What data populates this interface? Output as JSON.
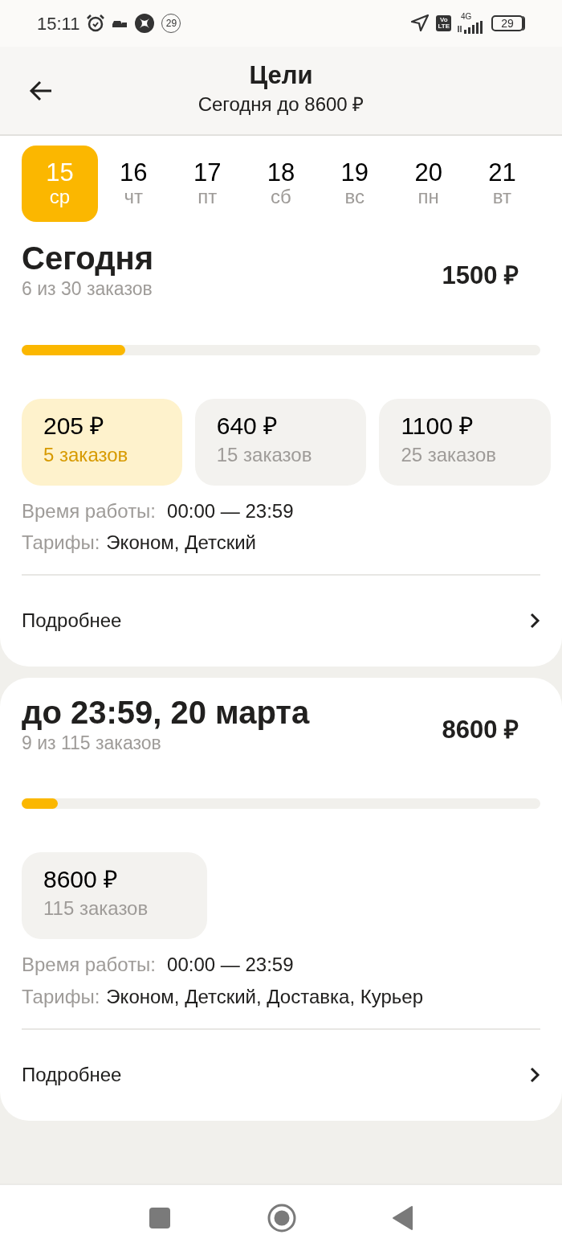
{
  "status_bar": {
    "time": "15:11",
    "badge": "29",
    "volte_top": "Vo",
    "volte_bottom": "LTE",
    "network": "4G",
    "battery": "29"
  },
  "header": {
    "title": "Цели",
    "subtitle": "Сегодня до 8600 ₽"
  },
  "days": [
    {
      "number": "15",
      "weekday": "ср",
      "selected": true
    },
    {
      "number": "16",
      "weekday": "чт",
      "selected": false
    },
    {
      "number": "17",
      "weekday": "пт",
      "selected": false
    },
    {
      "number": "18",
      "weekday": "сб",
      "selected": false
    },
    {
      "number": "19",
      "weekday": "вс",
      "selected": false
    },
    {
      "number": "20",
      "weekday": "пн",
      "selected": false
    },
    {
      "number": "21",
      "weekday": "вт",
      "selected": false
    }
  ],
  "goals": [
    {
      "title": "Сегодня",
      "progress_text": "6 из 30 заказов",
      "amount": "1500 ₽",
      "level": 0.2,
      "tiers": [
        {
          "amount": "205 ₽",
          "orders": "5 заказов",
          "selected": true
        },
        {
          "amount": "640 ₽",
          "orders": "15 заказов",
          "selected": false
        },
        {
          "amount": "1100 ₽",
          "orders": "25 заказов",
          "selected": false
        }
      ],
      "hours_label": "Время работы:",
      "hours": "00:00 — 23:59",
      "tariffs_label": "Тарифы:",
      "tariffs": "Эконом, Детский",
      "details": "Подробнее"
    },
    {
      "title": "до 23:59, 20 марта",
      "progress_text": "9 из 115 заказов",
      "amount": "8600 ₽",
      "level": 0.07,
      "tiers": [
        {
          "amount": "8600 ₽",
          "orders": "115 заказов",
          "selected": false
        }
      ],
      "hours_label": "Время работы:",
      "hours": "00:00 — 23:59",
      "tariffs_label": "Тарифы:",
      "tariffs": "Эконом, Детский, Доставка, Курьер",
      "details": "Подробнее"
    }
  ]
}
